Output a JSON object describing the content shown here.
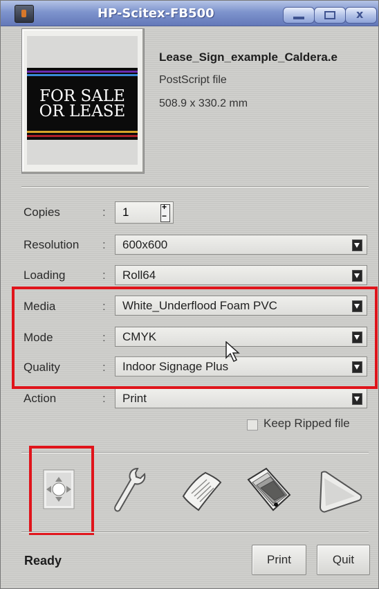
{
  "window": {
    "title": "HP-Scitex-FB500",
    "title_buttons": [
      "minimize",
      "maximize",
      "close"
    ],
    "close_glyph": "x"
  },
  "file": {
    "name": "Lease_Sign_example_Caldera.e",
    "type": "PostScript file",
    "size": "508.9 x 330.2 mm",
    "preview_text": [
      "FOR SALE",
      "OR LEASE"
    ]
  },
  "fields": {
    "copies": {
      "label": "Copies",
      "value": "1"
    },
    "resolution": {
      "label": "Resolution",
      "value": "600x600"
    },
    "loading": {
      "label": "Loading",
      "value": "Roll64"
    },
    "media": {
      "label": "Media",
      "value": "White_Underflood Foam PVC"
    },
    "mode": {
      "label": "Mode",
      "value": "CMYK"
    },
    "quality": {
      "label": "Quality",
      "value": "Indoor Signage Plus"
    },
    "action": {
      "label": "Action",
      "value": "Print"
    }
  },
  "colon": ":",
  "keep_ripped": {
    "label": "Keep Ripped file",
    "checked": false
  },
  "toolbar_icons": [
    "move-icon",
    "wrench-icon",
    "paper-icon",
    "color-swatch-icon",
    "cone-icon"
  ],
  "status": "Ready",
  "buttons": {
    "print": "Print",
    "quit": "Quit"
  },
  "colors": {
    "highlight": "#e0141b",
    "titlebar": "#7e94cd"
  }
}
